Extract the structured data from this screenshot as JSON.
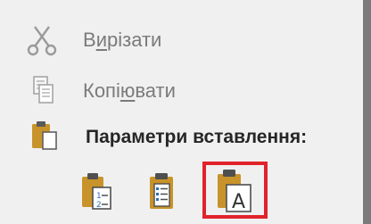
{
  "context_menu": {
    "items": [
      {
        "label_pre": "В",
        "label_accel": "и",
        "label_post": "різати",
        "icon": "scissors-icon",
        "enabled": false
      },
      {
        "label_pre": "Копі",
        "label_accel": "ю",
        "label_post": "вати",
        "icon": "copy-icon",
        "enabled": false
      }
    ],
    "paste_options": {
      "header": "Параметри вставлення:",
      "header_icon": "clipboard-icon",
      "buttons": [
        {
          "name": "keep-source-formatting",
          "icon": "paste-numbered-icon"
        },
        {
          "name": "merge-formatting",
          "icon": "paste-list-icon"
        },
        {
          "name": "keep-text-only",
          "icon": "paste-text-icon",
          "highlighted": true
        }
      ]
    },
    "colors": {
      "disabled_text": "#7b7b7b",
      "header_text": "#262626",
      "highlight_border": "#e0232b",
      "clipboard_orange": "#c8932a"
    }
  }
}
